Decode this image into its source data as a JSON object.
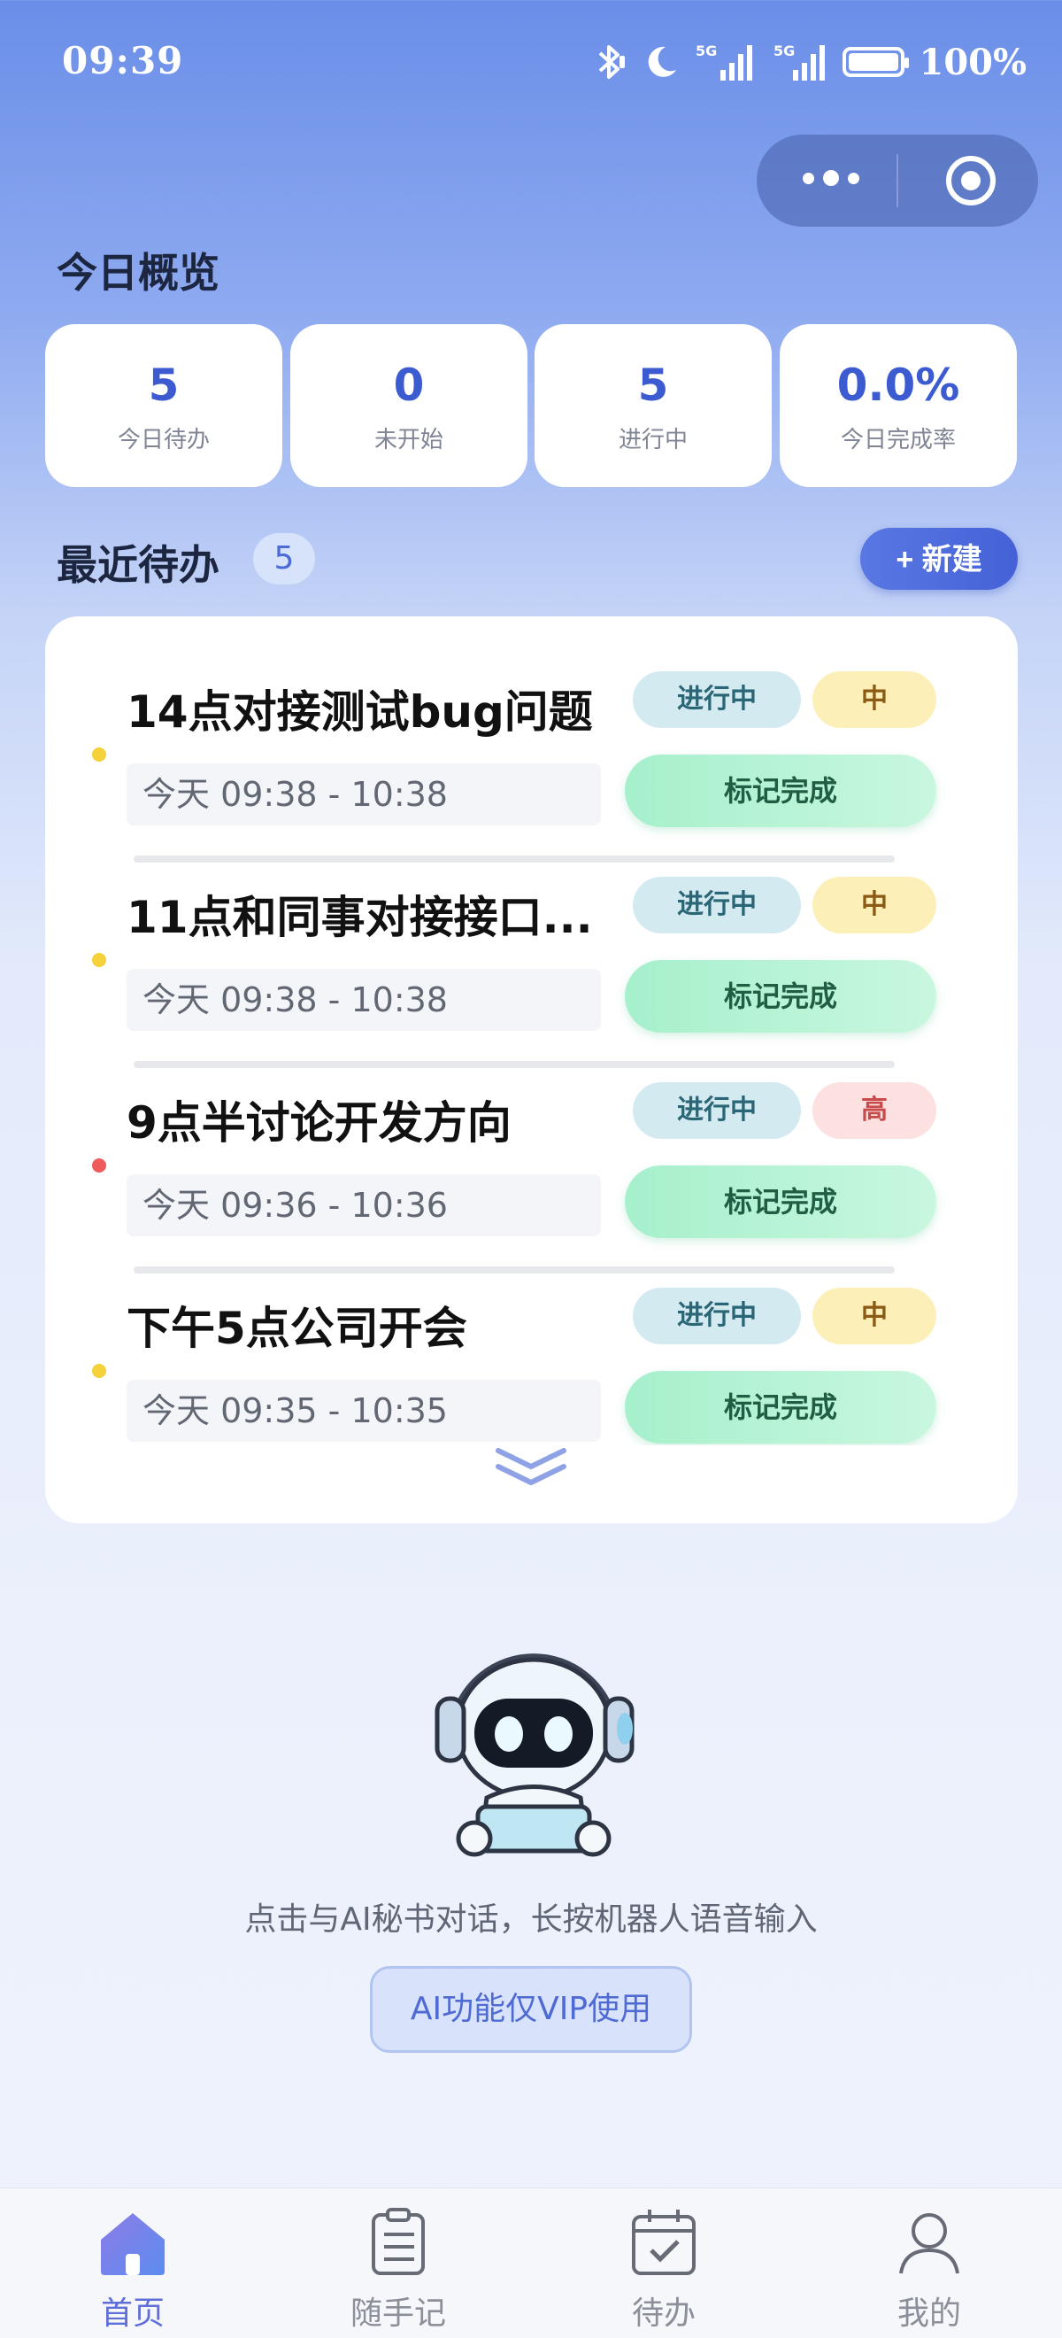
{
  "status_bar": {
    "time": "09:39",
    "battery": "100%",
    "signal_label": "5G"
  },
  "overview": {
    "title": "今日概览",
    "stats": [
      {
        "value": "5",
        "label": "今日待办"
      },
      {
        "value": "0",
        "label": "未开始"
      },
      {
        "value": "5",
        "label": "进行中"
      },
      {
        "value": "0.0%",
        "label": "今日完成率"
      }
    ]
  },
  "recent": {
    "title": "最近待办",
    "count": "5",
    "new_label": "+ 新建",
    "done_label": "标记完成",
    "items": [
      {
        "title": "14点对接测试bug问题",
        "time": "今天 09:38 - 10:38",
        "status": "进行中",
        "priority": "中",
        "dot_color": "#f5d23a"
      },
      {
        "title": "11点和同事对接接口...",
        "time": "今天 09:38 - 10:38",
        "status": "进行中",
        "priority": "中",
        "dot_color": "#f5d23a"
      },
      {
        "title": "9点半讨论开发方向",
        "time": "今天 09:36 - 10:36",
        "status": "进行中",
        "priority": "高",
        "dot_color": "#ef5a5a"
      },
      {
        "title": "下午5点公司开会",
        "time": "今天 09:35 - 10:35",
        "status": "进行中",
        "priority": "中",
        "dot_color": "#f5d23a"
      }
    ]
  },
  "ai": {
    "hint": "点击与AI秘书对话，长按机器人语音输入",
    "vip_label": "AI功能仅VIP使用"
  },
  "tabs": [
    {
      "label": "首页",
      "icon": "home-icon",
      "active": true
    },
    {
      "label": "随手记",
      "icon": "notes-icon",
      "active": false
    },
    {
      "label": "待办",
      "icon": "calendar-check-icon",
      "active": false
    },
    {
      "label": "我的",
      "icon": "user-icon",
      "active": false
    }
  ],
  "colors": {
    "accent": "#4462d6",
    "priority_mid": "#fdefb8",
    "priority_high": "#fde1e1",
    "done": "#a6f0cc"
  }
}
